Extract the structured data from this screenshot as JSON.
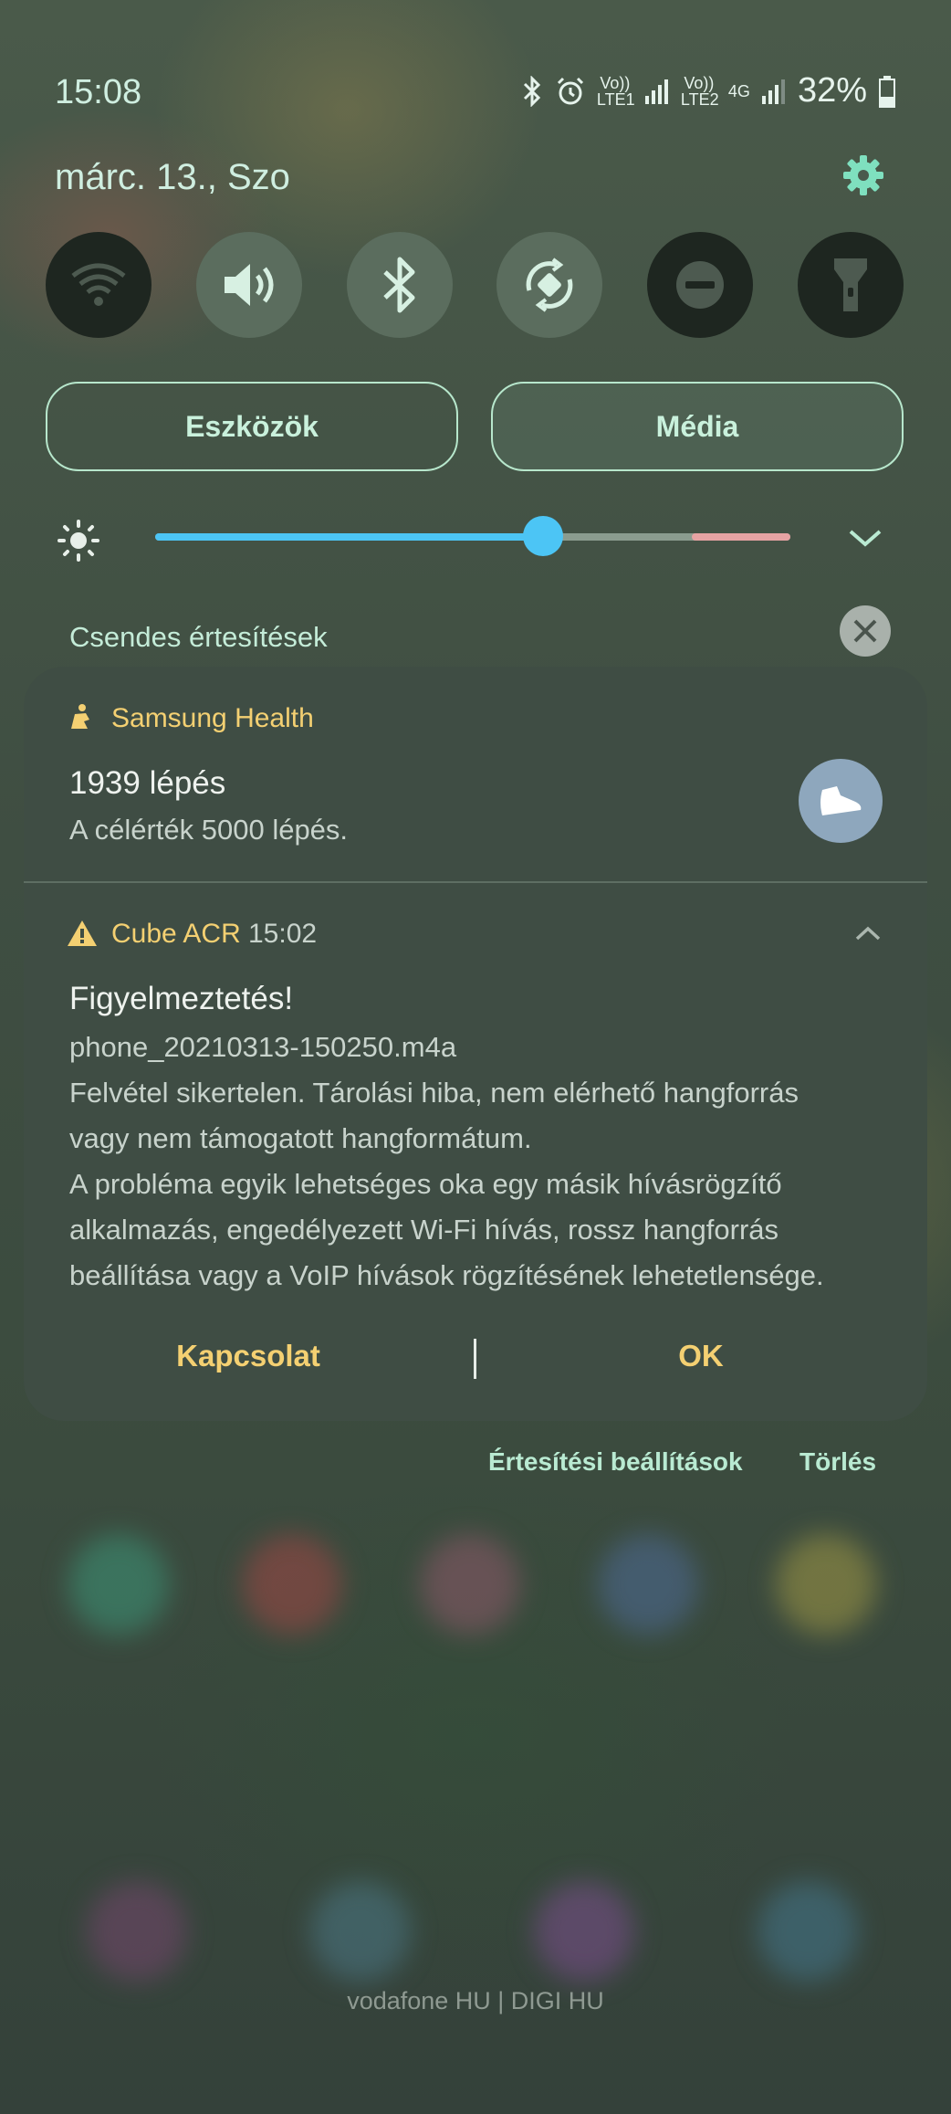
{
  "status_bar": {
    "time": "15:08",
    "sim1_label": "Vo)) LTE1",
    "sim2_label": "Vo)) LTE2",
    "net_label": "4G",
    "battery": "32%"
  },
  "header": {
    "date": "márc. 13., Szo"
  },
  "quick_settings": [
    {
      "name": "wifi-icon",
      "state": "off"
    },
    {
      "name": "sound-icon",
      "state": "on"
    },
    {
      "name": "bluetooth-icon",
      "state": "on"
    },
    {
      "name": "auto-rotate-icon",
      "state": "on"
    },
    {
      "name": "do-not-disturb-icon",
      "state": "off"
    },
    {
      "name": "flashlight-icon",
      "state": "off"
    }
  ],
  "panels": {
    "devices_label": "Eszközök",
    "media_label": "Média"
  },
  "brightness": {
    "level": 0.61
  },
  "silent_section": {
    "label": "Csendes értesítések"
  },
  "notifications": {
    "health": {
      "app": "Samsung Health",
      "title": "1939 lépés",
      "text": "A célérték 5000 lépés."
    },
    "acr": {
      "app": "Cube ACR",
      "time": "15:02",
      "title": "Figyelmeztetés!",
      "line1": "phone_20210313-150250.m4a",
      "line2": "Felvétel sikertelen. Tárolási hiba, nem elérhető hangforrás",
      "line3": "vagy nem támogatott hangformátum.",
      "line4": "A probléma egyik lehetséges oka egy másik hívásrögzítő",
      "line5": "alkalmazás, engedélyezett Wi-Fi hívás, rossz hangforrás",
      "line6": "beállítása vagy a VoIP hívások rögzítésének lehetetlensége.",
      "action_contact": "Kapcsolat",
      "action_ok": "OK"
    }
  },
  "footer": {
    "settings": "Értesítési beállítások",
    "clear": "Törlés"
  },
  "carrier": "vodafone HU | DIGI HU",
  "colors": {
    "accent": "#f4d072",
    "mint": "#c9f1dc",
    "slider": "#4cc5f5",
    "card": "#3f4d44"
  }
}
